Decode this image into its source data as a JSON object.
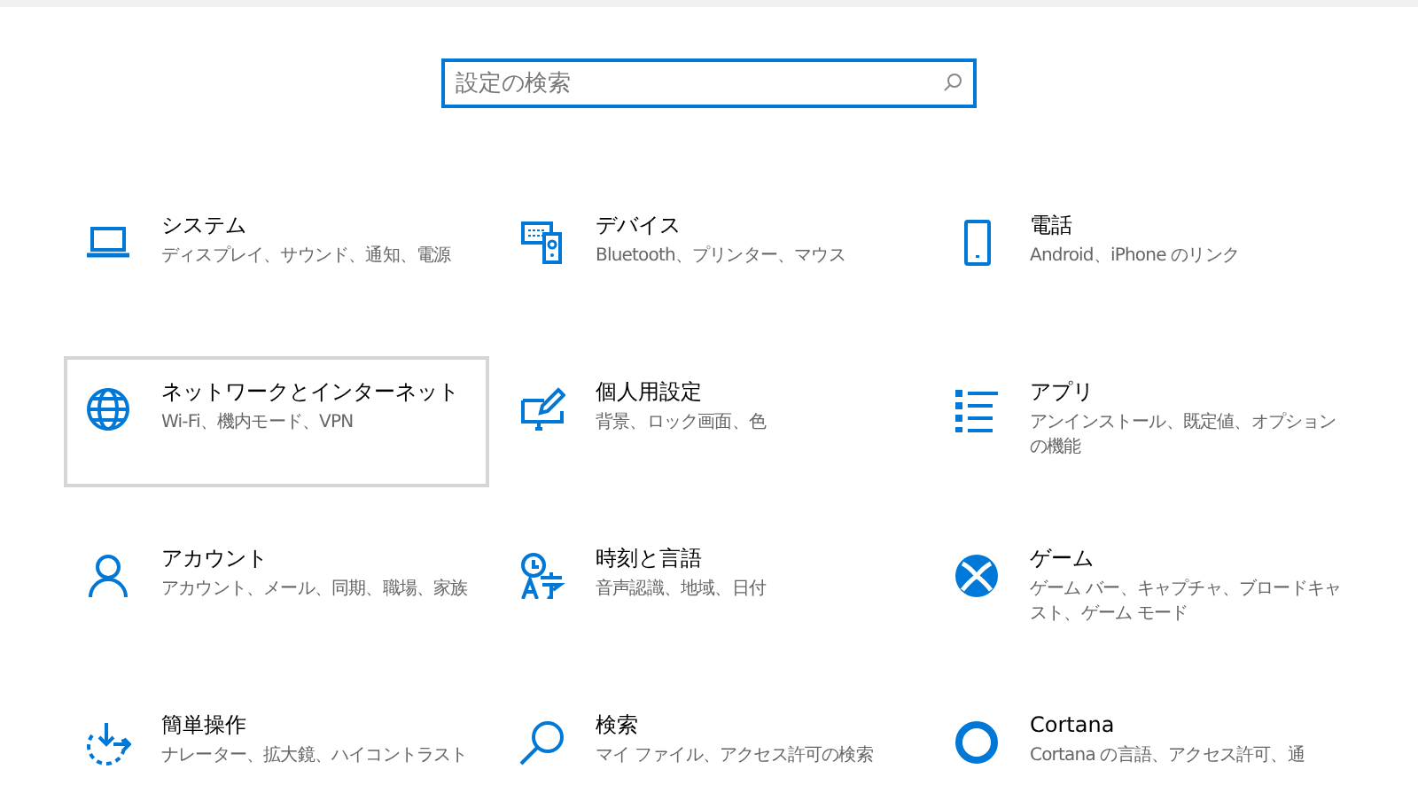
{
  "search": {
    "placeholder": "設定の検索"
  },
  "categories": [
    {
      "title": "システム",
      "description": "ディスプレイ、サウンド、通知、電源",
      "hovered": false
    },
    {
      "title": "デバイス",
      "description": "Bluetooth、プリンター、マウス",
      "hovered": false
    },
    {
      "title": "電話",
      "description": "Android、iPhone のリンク",
      "hovered": false
    },
    {
      "title": "ネットワークとインターネット",
      "description": "Wi-Fi、機内モード、VPN",
      "hovered": true
    },
    {
      "title": "個人用設定",
      "description": "背景、ロック画面、色",
      "hovered": false
    },
    {
      "title": "アプリ",
      "description": "アンインストール、既定値、オプションの機能",
      "hovered": false
    },
    {
      "title": "アカウント",
      "description": "アカウント、メール、同期、職場、家族",
      "hovered": false
    },
    {
      "title": "時刻と言語",
      "description": "音声認識、地域、日付",
      "hovered": false
    },
    {
      "title": "ゲーム",
      "description": "ゲーム バー、キャプチャ、ブロードキャスト、ゲーム モード",
      "hovered": false
    },
    {
      "title": "簡単操作",
      "description": "ナレーター、拡大鏡、ハイコントラスト",
      "hovered": false
    },
    {
      "title": "検索",
      "description": "マイ ファイル、アクセス許可の検索",
      "hovered": false
    },
    {
      "title": "Cortana",
      "description": "Cortana の言語、アクセス許可、通",
      "hovered": false
    }
  ]
}
